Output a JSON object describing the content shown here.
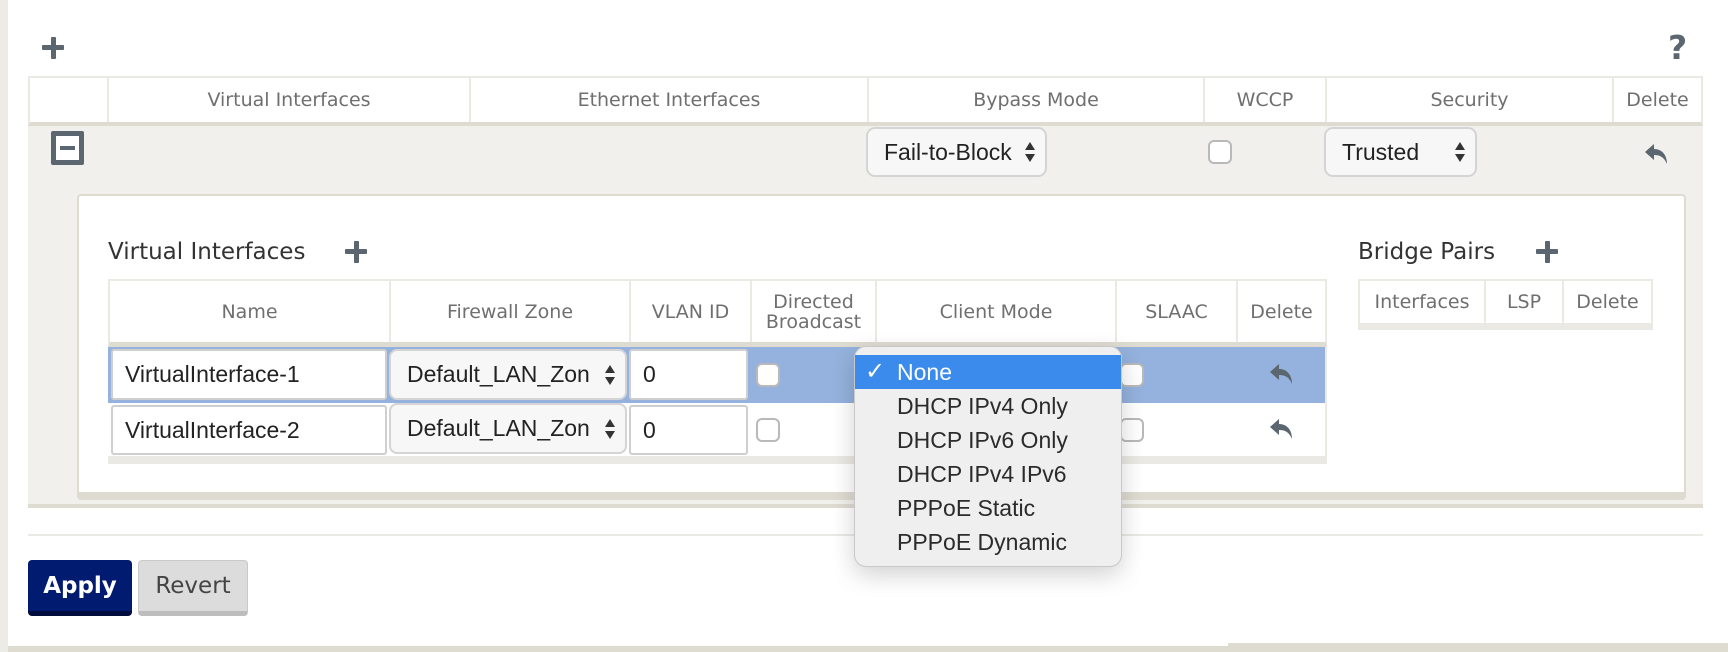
{
  "toolbar": {
    "add_icon": "plus-icon",
    "help_label": "?"
  },
  "outer_table": {
    "columns": [
      "",
      "Virtual Interfaces",
      "Ethernet Interfaces",
      "Bypass Mode",
      "WCCP",
      "Security",
      "Delete"
    ],
    "row": {
      "collapse_icon": "minus-square-icon",
      "bypass_mode": "Fail-to-Block",
      "wccp_checked": false,
      "security": "Trusted",
      "delete_icon": "undo-icon"
    }
  },
  "virtual_interfaces": {
    "heading": "Virtual Interfaces",
    "add_icon": "plus-icon",
    "columns": [
      "Name",
      "Firewall Zone",
      "VLAN ID",
      "Directed Broadcast",
      "Client Mode",
      "SLAAC",
      "Delete"
    ],
    "rows": [
      {
        "name": "VirtualInterface-1",
        "firewall_zone": "Default_LAN_Zon",
        "vlan_id": "0",
        "directed_broadcast": false,
        "client_mode": "None",
        "slaac": false,
        "selected": true
      },
      {
        "name": "VirtualInterface-2",
        "firewall_zone": "Default_LAN_Zon",
        "vlan_id": "0",
        "directed_broadcast": false,
        "client_mode": "None",
        "slaac": false,
        "selected": false
      }
    ]
  },
  "bridge_pairs": {
    "heading": "Bridge Pairs",
    "add_icon": "plus-icon",
    "columns": [
      "Interfaces",
      "LSP",
      "Delete"
    ]
  },
  "client_mode_dropdown": {
    "check_glyph": "✓",
    "selected": "None",
    "options": [
      "None",
      "DHCP IPv4 Only",
      "DHCP IPv6 Only",
      "DHCP IPv4 IPv6",
      "PPPoE Static",
      "PPPoE Dynamic"
    ]
  },
  "colors": {
    "apply_button": "#001b70",
    "selected_row": "#94b2dd",
    "dropdown_highlight": "#3b8bed",
    "icon": "#5b6670"
  },
  "footer": {
    "apply_label": "Apply",
    "revert_label": "Revert"
  }
}
